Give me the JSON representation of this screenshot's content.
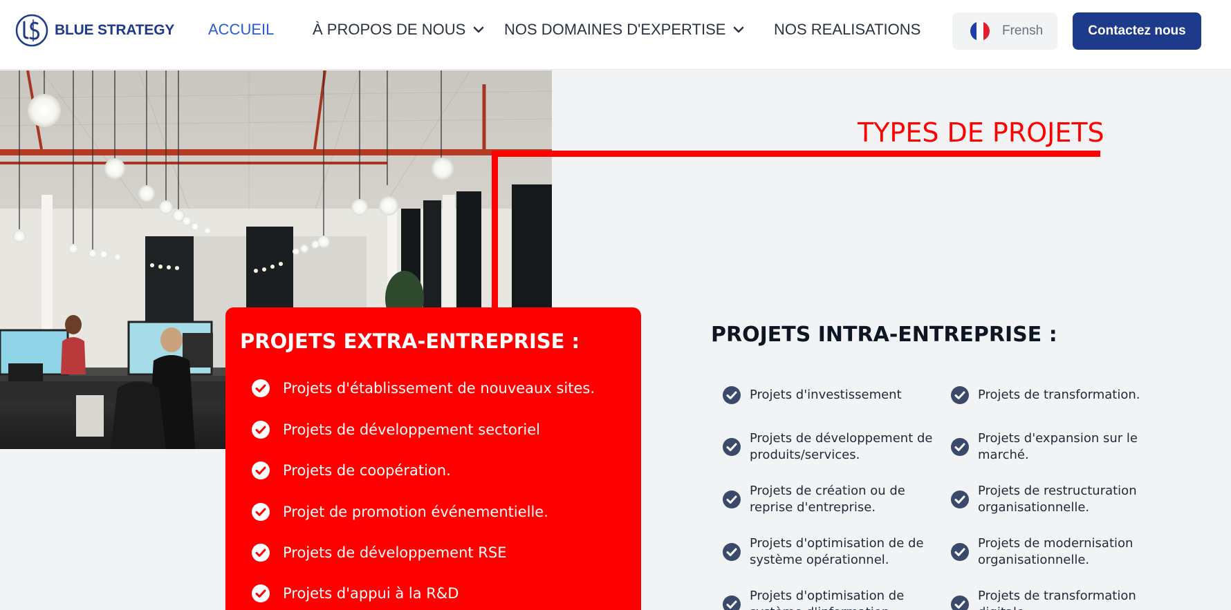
{
  "header": {
    "brand": "BLUE STRATEGY",
    "nav": {
      "home": "ACCUEIL",
      "about": "À PROPOS DE NOUS",
      "expertise": "NOS DOMAINES D'EXPERTISE",
      "realisations": "NOS REALISATIONS"
    },
    "language_label": "Frensh",
    "contact_label": "Contactez nous"
  },
  "section": {
    "title": "TYPES DE PROJETS"
  },
  "extra": {
    "title": "PROJETS EXTRA-ENTREPRISE :",
    "items": [
      "Projets d'établissement de nouveaux sites.",
      "Projets de développement sectoriel",
      "Projets de coopération.",
      "Projet de promotion événementielle.",
      "Projets de développement RSE",
      "Projets d'appui à la R&D"
    ]
  },
  "intra": {
    "title": "PROJETS INTRA-ENTREPRISE :",
    "items": [
      "Projets d'investissement",
      "Projets de transformation.",
      "Projets de développement de produits/services.",
      "Projets d'expansion sur le marché.",
      "Projets de création ou de reprise d'entreprise.",
      "Projets de restructuration organisationnelle.",
      "Projets d'optimisation de de système opérationnel.",
      "Projets de modernisation organisationnelle.",
      "Projets d'optimisation de système d'information.",
      "Projets de transformation digitale."
    ]
  },
  "icons": {
    "logo": "bs-logo-mark",
    "nav_dropdown": "chevron-down-icon",
    "flag": "france-flag-icon",
    "list_check": "check-circle-icon"
  },
  "colors": {
    "brand_blue": "#1e3a8a",
    "active_nav": "#2a5bd7",
    "accent_red": "#ff0000",
    "check_navy": "#3b4a6b",
    "background": "#f2f3f5"
  }
}
